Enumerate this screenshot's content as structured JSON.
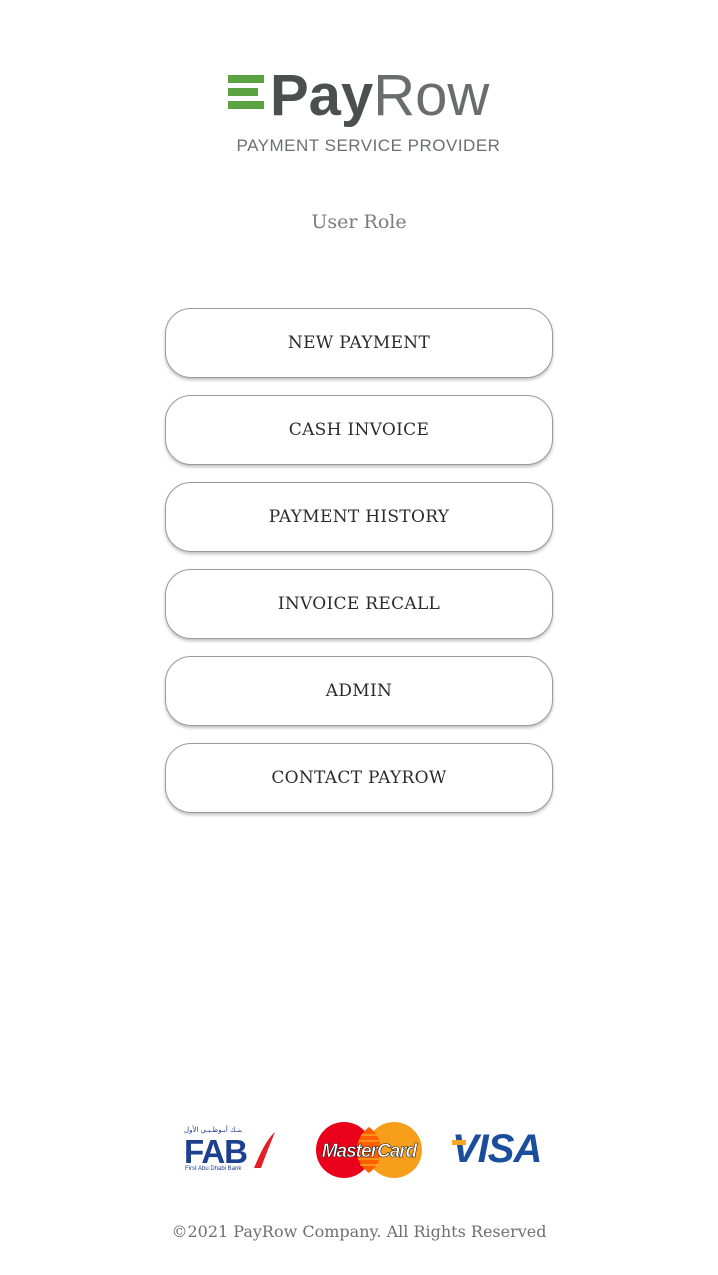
{
  "header": {
    "logo_pay": "Pay",
    "logo_row": "Row",
    "tagline": "PAYMENT SERVICE PROVIDER"
  },
  "page_title": "User Role",
  "menu": [
    {
      "label": "NEW PAYMENT"
    },
    {
      "label": "CASH INVOICE"
    },
    {
      "label": "PAYMENT HISTORY"
    },
    {
      "label": "INVOICE RECALL"
    },
    {
      "label": "ADMIN"
    },
    {
      "label": "CONTACT PAYROW"
    }
  ],
  "partners": {
    "fab": {
      "arabic": "بنـك أبـوظـبـي الأول",
      "text": "FAB",
      "subtext": "First Abu Dhabi Bank"
    },
    "mastercard": {
      "text": "MasterCard"
    },
    "visa": {
      "text": "VISA"
    }
  },
  "footer": {
    "copyright": "©2021 PayRow Company. All Rights Reserved"
  },
  "colors": {
    "brand_green": "#5aa244",
    "brand_gray": "#58595b",
    "fab_blue": "#1d3f8f",
    "fab_red": "#e31e24",
    "visa_blue": "#1a4d9c",
    "mc_red": "#eb001b",
    "mc_orange": "#f79e1b"
  }
}
